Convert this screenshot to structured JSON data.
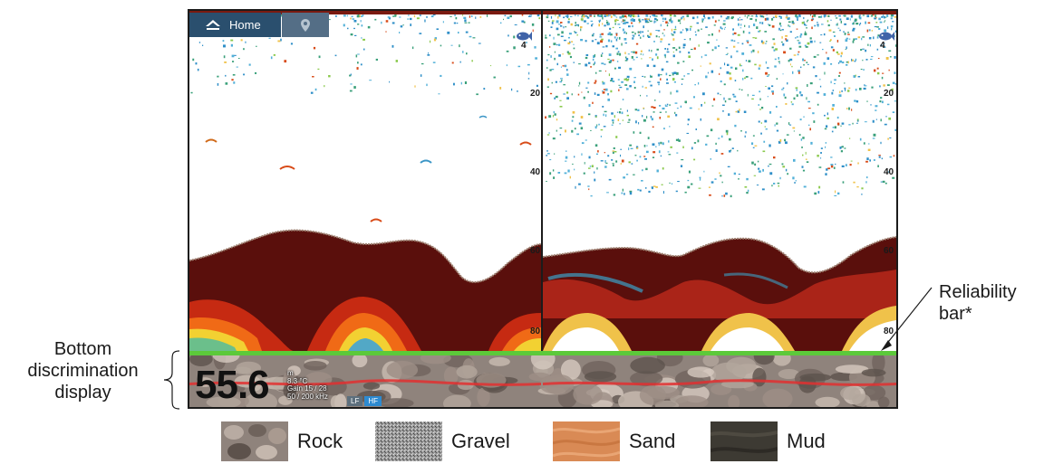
{
  "home_bar": {
    "home_label": "Home"
  },
  "depth_scale": {
    "left": [
      "4",
      "20",
      "40",
      "60",
      "80"
    ],
    "right": [
      "4",
      "20",
      "40",
      "60",
      "80"
    ]
  },
  "readout": {
    "depth": "55.6",
    "unit": "m",
    "temperature": "8.3 °C",
    "gain": "Gain 15 / 28",
    "frequency": "50 / 200 kHz",
    "lf_label": "LF",
    "hf_label": "HF"
  },
  "callouts": {
    "bottom_discrimination": [
      "Bottom",
      "discrimination",
      "display"
    ],
    "reliability": [
      "Reliability",
      "bar*"
    ]
  },
  "legend": [
    {
      "label": "Rock",
      "color": "#8f837c"
    },
    {
      "label": "Gravel",
      "color": "#9a9a9a"
    },
    {
      "label": "Sand",
      "color": "#d98a55"
    },
    {
      "label": "Mud",
      "color": "#3d3a33"
    }
  ],
  "colors": {
    "seabed": "#5a0f0c",
    "home_bar": "#2a4f6e",
    "reliability_bar": "#5cc93a",
    "hf_tag": "#2d8ad0"
  }
}
